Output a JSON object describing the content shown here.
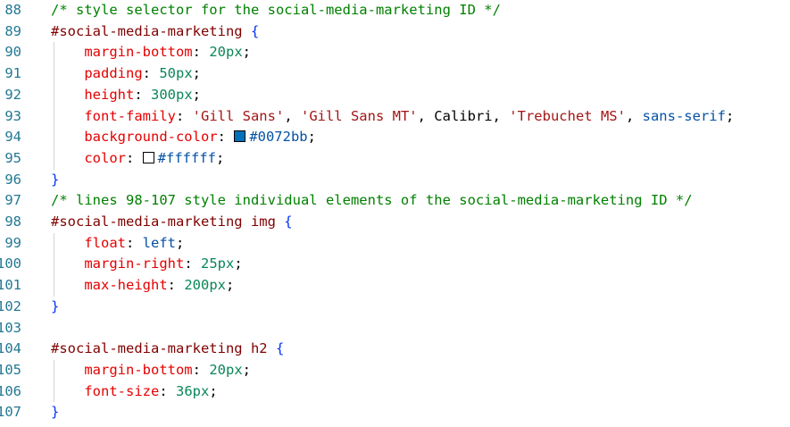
{
  "editor": {
    "lines": [
      {
        "num": "88",
        "indent": "",
        "tokens": [
          {
            "t": "/* style selector for the social-media-marketing ID */",
            "c": "comment"
          }
        ]
      },
      {
        "num": "89",
        "indent": "",
        "tokens": [
          {
            "t": "#social-media-marketing ",
            "c": "selector"
          },
          {
            "t": "{",
            "c": "brace"
          }
        ]
      },
      {
        "num": "90",
        "indent": "    ",
        "tokens": [
          {
            "t": "margin-bottom",
            "c": "prop"
          },
          {
            "t": ": ",
            "c": "punc"
          },
          {
            "t": "20px",
            "c": "num"
          },
          {
            "t": ";",
            "c": "punc"
          }
        ]
      },
      {
        "num": "91",
        "indent": "    ",
        "tokens": [
          {
            "t": "padding",
            "c": "prop"
          },
          {
            "t": ": ",
            "c": "punc"
          },
          {
            "t": "50px",
            "c": "num"
          },
          {
            "t": ";",
            "c": "punc"
          }
        ]
      },
      {
        "num": "92",
        "indent": "    ",
        "tokens": [
          {
            "t": "height",
            "c": "prop"
          },
          {
            "t": ": ",
            "c": "punc"
          },
          {
            "t": "300px",
            "c": "num"
          },
          {
            "t": ";",
            "c": "punc"
          }
        ]
      },
      {
        "num": "93",
        "indent": "    ",
        "tokens": [
          {
            "t": "font-family",
            "c": "prop"
          },
          {
            "t": ": ",
            "c": "punc"
          },
          {
            "t": "'Gill Sans'",
            "c": "str"
          },
          {
            "t": ", ",
            "c": "punc"
          },
          {
            "t": "'Gill Sans MT'",
            "c": "str"
          },
          {
            "t": ", Calibri, ",
            "c": "ident"
          },
          {
            "t": "'Trebuchet MS'",
            "c": "str"
          },
          {
            "t": ", ",
            "c": "punc"
          },
          {
            "t": "sans-serif",
            "c": "kw"
          },
          {
            "t": ";",
            "c": "punc"
          }
        ]
      },
      {
        "num": "94",
        "indent": "    ",
        "tokens": [
          {
            "t": "background-color",
            "c": "prop"
          },
          {
            "t": ": ",
            "c": "punc"
          },
          {
            "swatch": "#0072bb"
          },
          {
            "t": "#0072bb",
            "c": "kw"
          },
          {
            "t": ";",
            "c": "punc"
          }
        ]
      },
      {
        "num": "95",
        "indent": "    ",
        "tokens": [
          {
            "t": "color",
            "c": "prop"
          },
          {
            "t": ": ",
            "c": "punc"
          },
          {
            "swatch": "#ffffff"
          },
          {
            "t": "#ffffff",
            "c": "kw"
          },
          {
            "t": ";",
            "c": "punc"
          }
        ]
      },
      {
        "num": "96",
        "indent": "",
        "tokens": [
          {
            "t": "}",
            "c": "brace"
          }
        ]
      },
      {
        "num": "97",
        "indent": "",
        "tokens": [
          {
            "t": "/* lines 98-107 style individual elements of the social-media-marketing ID */",
            "c": "comment"
          }
        ]
      },
      {
        "num": "98",
        "indent": "",
        "tokens": [
          {
            "t": "#social-media-marketing img ",
            "c": "selector"
          },
          {
            "t": "{",
            "c": "brace"
          }
        ]
      },
      {
        "num": "99",
        "indent": "    ",
        "tokens": [
          {
            "t": "float",
            "c": "prop"
          },
          {
            "t": ": ",
            "c": "punc"
          },
          {
            "t": "left",
            "c": "kw"
          },
          {
            "t": ";",
            "c": "punc"
          }
        ]
      },
      {
        "num": "100",
        "indent": "    ",
        "tokens": [
          {
            "t": "margin-right",
            "c": "prop"
          },
          {
            "t": ": ",
            "c": "punc"
          },
          {
            "t": "25px",
            "c": "num"
          },
          {
            "t": ";",
            "c": "punc"
          }
        ]
      },
      {
        "num": "101",
        "indent": "    ",
        "tokens": [
          {
            "t": "max-height",
            "c": "prop"
          },
          {
            "t": ": ",
            "c": "punc"
          },
          {
            "t": "200px",
            "c": "num"
          },
          {
            "t": ";",
            "c": "punc"
          }
        ]
      },
      {
        "num": "102",
        "indent": "",
        "tokens": [
          {
            "t": "}",
            "c": "brace"
          }
        ]
      },
      {
        "num": "103",
        "indent": "",
        "tokens": []
      },
      {
        "num": "104",
        "indent": "",
        "tokens": [
          {
            "t": "#social-media-marketing h2 ",
            "c": "selector"
          },
          {
            "t": "{",
            "c": "brace"
          }
        ]
      },
      {
        "num": "105",
        "indent": "    ",
        "tokens": [
          {
            "t": "margin-bottom",
            "c": "prop"
          },
          {
            "t": ": ",
            "c": "punc"
          },
          {
            "t": "20px",
            "c": "num"
          },
          {
            "t": ";",
            "c": "punc"
          }
        ]
      },
      {
        "num": "106",
        "indent": "    ",
        "tokens": [
          {
            "t": "font-size",
            "c": "prop"
          },
          {
            "t": ": ",
            "c": "punc"
          },
          {
            "t": "36px",
            "c": "num"
          },
          {
            "t": ";",
            "c": "punc"
          }
        ]
      },
      {
        "num": "107",
        "indent": "",
        "tokens": [
          {
            "t": "}",
            "c": "brace"
          }
        ]
      }
    ]
  },
  "colors": {
    "comment": "#008000",
    "selector": "#800000",
    "brace": "#0431fa",
    "prop": "#e50000",
    "num": "#098658",
    "str": "#a31515",
    "kw": "#0451a5",
    "line_number": "#237893"
  }
}
